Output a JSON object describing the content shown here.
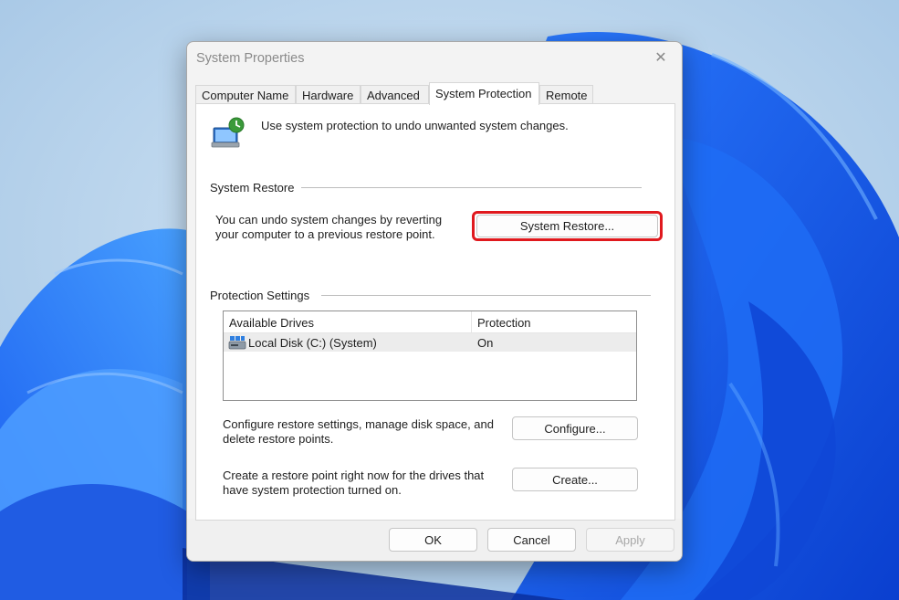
{
  "dialog": {
    "title": "System Properties",
    "close_icon": "close-icon"
  },
  "tabs": [
    {
      "label": "Computer Name"
    },
    {
      "label": "Hardware"
    },
    {
      "label": "Advanced"
    },
    {
      "label": "System Protection"
    },
    {
      "label": "Remote"
    }
  ],
  "active_tab": "System Protection",
  "header": {
    "icon": "system-protection-icon",
    "text": "Use system protection to undo unwanted system changes."
  },
  "system_restore": {
    "group_label": "System Restore",
    "description_line1": "You can undo system changes by reverting",
    "description_line2": "your computer to a previous restore point.",
    "button_label": "System Restore...",
    "highlight_color": "#e0191e"
  },
  "protection_settings": {
    "group_label": "Protection Settings",
    "columns": [
      "Available Drives",
      "Protection"
    ],
    "rows": [
      {
        "drive": "Local Disk (C:) (System)",
        "protection": "On",
        "icon": "drive-icon"
      }
    ],
    "configure_text_line1": "Configure restore settings, manage disk space, and",
    "configure_text_line2": "delete restore points.",
    "configure_button": "Configure...",
    "create_text_line1": "Create a restore point right now for the drives that",
    "create_text_line2": "have system protection turned on.",
    "create_button": "Create..."
  },
  "footer": {
    "ok": "OK",
    "cancel": "Cancel",
    "apply": "Apply"
  }
}
